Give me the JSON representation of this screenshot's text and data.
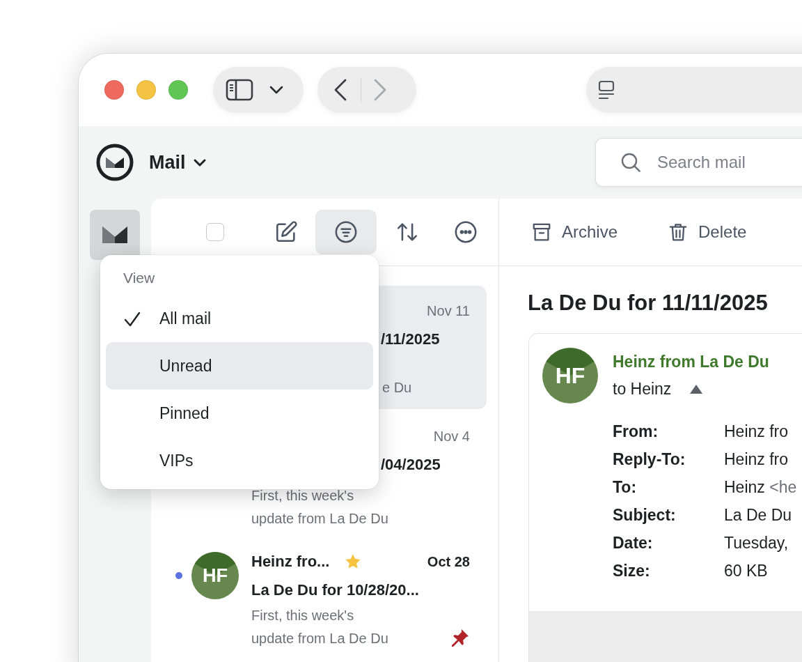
{
  "window": {
    "nav": [
      {
        "kind": "back",
        "disabled": false
      },
      {
        "kind": "forward",
        "disabled": true
      }
    ]
  },
  "app": {
    "name": "Mail"
  },
  "search": {
    "placeholder": "Search mail"
  },
  "list_toolbar": [
    {
      "kind": "checkbox",
      "checked": false,
      "selected": false
    },
    {
      "kind": "compose",
      "selected": false
    },
    {
      "kind": "filter",
      "selected": true
    },
    {
      "kind": "sort",
      "selected": false
    },
    {
      "kind": "more",
      "selected": false
    }
  ],
  "messages": [
    {
      "kind": "covered",
      "selected": true,
      "unread": false,
      "date": "Nov 11",
      "subject": "/11/2025",
      "preview": "e Du"
    },
    {
      "kind": "partial",
      "selected": false,
      "unread": false,
      "date": "Nov 4",
      "subject": "/04/2025",
      "preview": "First, this week's update from La De Du"
    },
    {
      "kind": "full",
      "selected": false,
      "unread": true,
      "initials": "HF",
      "sender": "Heinz fro...",
      "starred": true,
      "pinned": true,
      "date": "Oct 28",
      "subject": "La De Du for 10/28/20...",
      "preview": "First, this week's update from La De Du"
    }
  ],
  "view_menu": {
    "title": "View",
    "items": [
      {
        "label": "All mail",
        "checked": true,
        "highlighted": false
      },
      {
        "label": "Unread",
        "checked": false,
        "highlighted": true
      },
      {
        "label": "Pinned",
        "checked": false,
        "highlighted": false
      },
      {
        "label": "VIPs",
        "checked": false,
        "highlighted": false
      }
    ]
  },
  "reader": {
    "actions": [
      {
        "kind": "archive",
        "label": "Archive"
      },
      {
        "kind": "delete",
        "label": "Delete"
      }
    ],
    "title": "La De Du for 11/11/2025",
    "message": {
      "initials": "HF",
      "sender": "Heinz from La De Du",
      "recipient": "to Heinz",
      "details_expanded": true,
      "details": [
        {
          "label": "From:",
          "value": "Heinz fro"
        },
        {
          "label": "Reply-To:",
          "value": "Heinz fro"
        },
        {
          "label": "To:",
          "value": "Heinz",
          "extra": "<he"
        },
        {
          "label": "Subject:",
          "value": "La De Du"
        },
        {
          "label": "Date:",
          "value": "Tuesday,"
        },
        {
          "label": "Size:",
          "value": "60 KB"
        }
      ]
    }
  }
}
